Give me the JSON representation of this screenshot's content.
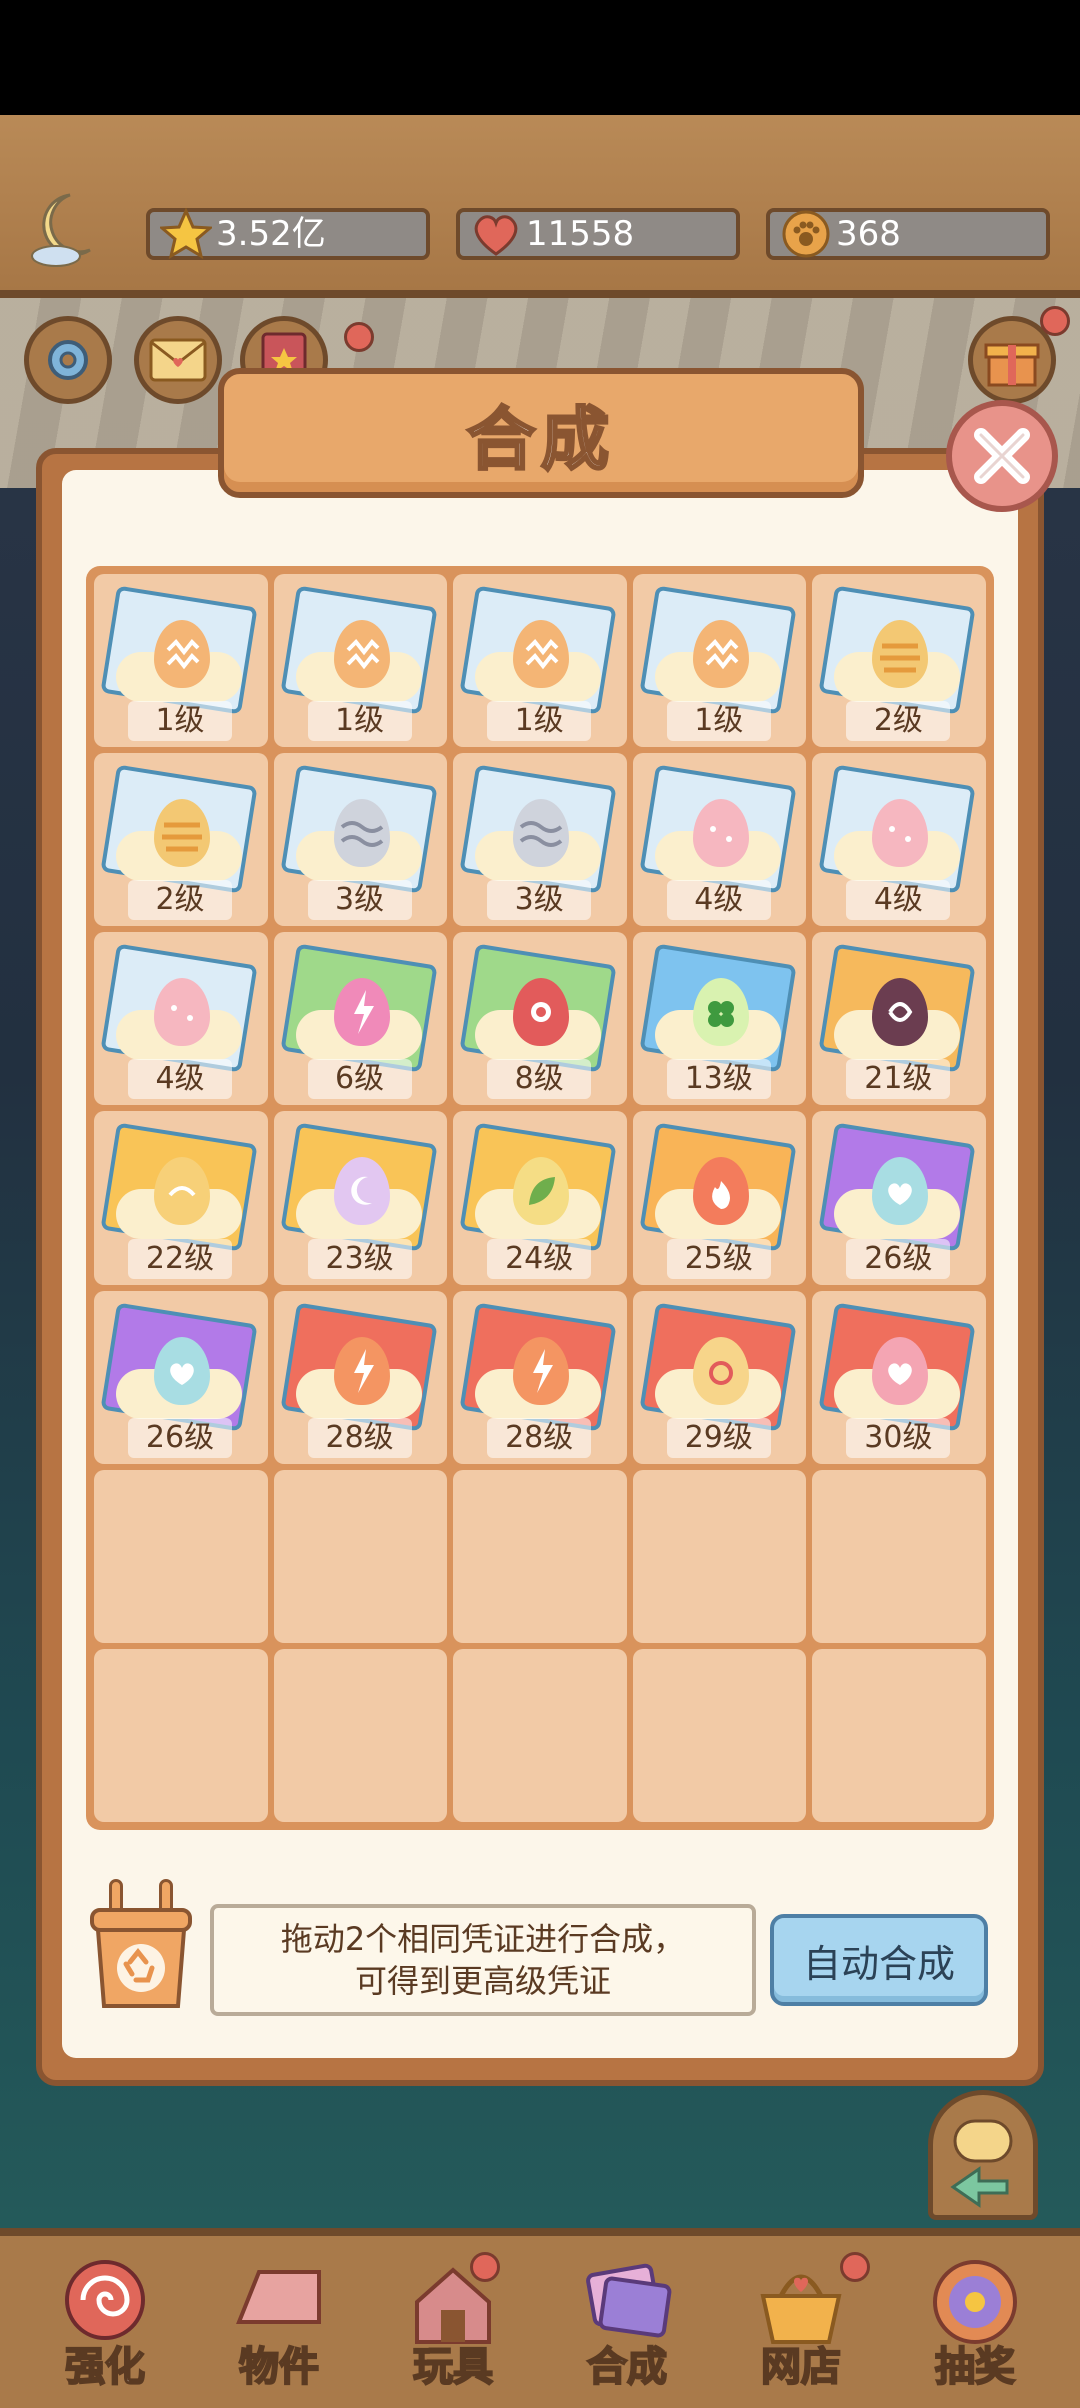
{
  "resources": {
    "stars": "3.52亿",
    "hearts": "11558",
    "paws": "368"
  },
  "dialog": {
    "title": "合成",
    "hint_line1": "拖动2个相同凭证进行合成，",
    "hint_line2": "可得到更高级凭证",
    "auto_button": "自动合成"
  },
  "cards": [
    {
      "level": "1级",
      "card_color": "#dcecf7",
      "egg_color": "#f4b575",
      "mark": "zigzag"
    },
    {
      "level": "1级",
      "card_color": "#dcecf7",
      "egg_color": "#f4b575",
      "mark": "zigzag"
    },
    {
      "level": "1级",
      "card_color": "#dcecf7",
      "egg_color": "#f4b575",
      "mark": "zigzag"
    },
    {
      "level": "1级",
      "card_color": "#dcecf7",
      "egg_color": "#f4b575",
      "mark": "zigzag"
    },
    {
      "level": "2级",
      "card_color": "#dcecf7",
      "egg_color": "#f3c873",
      "mark": "stripe"
    },
    {
      "level": "2级",
      "card_color": "#dcecf7",
      "egg_color": "#f3c873",
      "mark": "stripe"
    },
    {
      "level": "3级",
      "card_color": "#dcecf7",
      "egg_color": "#cfd3dc",
      "mark": "wave"
    },
    {
      "level": "3级",
      "card_color": "#dcecf7",
      "egg_color": "#cfd3dc",
      "mark": "wave"
    },
    {
      "level": "4级",
      "card_color": "#dcecf7",
      "egg_color": "#f6b7c0",
      "mark": "dots"
    },
    {
      "level": "4级",
      "card_color": "#dcecf7",
      "egg_color": "#f6b7c0",
      "mark": "dots"
    },
    {
      "level": "4级",
      "card_color": "#dcecf7",
      "egg_color": "#f6b7c0",
      "mark": "dots"
    },
    {
      "level": "6级",
      "card_color": "#9fd98a",
      "egg_color": "#f08ab9",
      "mark": "bolt"
    },
    {
      "level": "8级",
      "card_color": "#9fd98a",
      "egg_color": "#e25b5b",
      "mark": "rose"
    },
    {
      "level": "13级",
      "card_color": "#7ec3ef",
      "egg_color": "#d9f2b0",
      "mark": "clover"
    },
    {
      "level": "21级",
      "card_color": "#f6b95c",
      "egg_color": "#6b3d50",
      "mark": "swirl"
    },
    {
      "level": "22级",
      "card_color": "#f9c457",
      "egg_color": "#f7d078",
      "mark": "bird"
    },
    {
      "level": "23级",
      "card_color": "#f9c457",
      "egg_color": "#e2c7f1",
      "mark": "moon"
    },
    {
      "level": "24级",
      "card_color": "#f9c457",
      "egg_color": "#f5dd85",
      "mark": "leaf"
    },
    {
      "level": "25级",
      "card_color": "#f9b457",
      "egg_color": "#f37c5c",
      "mark": "flame"
    },
    {
      "level": "26级",
      "card_color": "#b27ae8",
      "egg_color": "#a8dde3",
      "mark": "heart"
    },
    {
      "level": "26级",
      "card_color": "#b27ae8",
      "egg_color": "#a8dde3",
      "mark": "heart"
    },
    {
      "level": "28级",
      "card_color": "#ef6f5d",
      "egg_color": "#f49562",
      "mark": "bolt"
    },
    {
      "level": "28级",
      "card_color": "#ef6f5d",
      "egg_color": "#f49562",
      "mark": "bolt"
    },
    {
      "level": "29级",
      "card_color": "#ef6f5d",
      "egg_color": "#f7d58a",
      "mark": "fire"
    },
    {
      "level": "30级",
      "card_color": "#ef6f5d",
      "egg_color": "#f4a5b3",
      "mark": "heart"
    },
    null,
    null,
    null,
    null,
    null,
    null,
    null,
    null,
    null,
    null
  ],
  "nav": [
    {
      "label": "强化",
      "icon": "lollipop-icon",
      "color": "#e0675a"
    },
    {
      "label": "物件",
      "icon": "piano-icon",
      "color": "#e7a3a0"
    },
    {
      "label": "玩具",
      "icon": "cat-house-icon",
      "color": "#d78b8b"
    },
    {
      "label": "合成",
      "icon": "cards-icon",
      "color": "#9b7fd6"
    },
    {
      "label": "网店",
      "icon": "basket-icon",
      "color": "#f2b24c"
    },
    {
      "label": "抽奖",
      "icon": "wheel-icon",
      "color": "#e28a54"
    }
  ]
}
